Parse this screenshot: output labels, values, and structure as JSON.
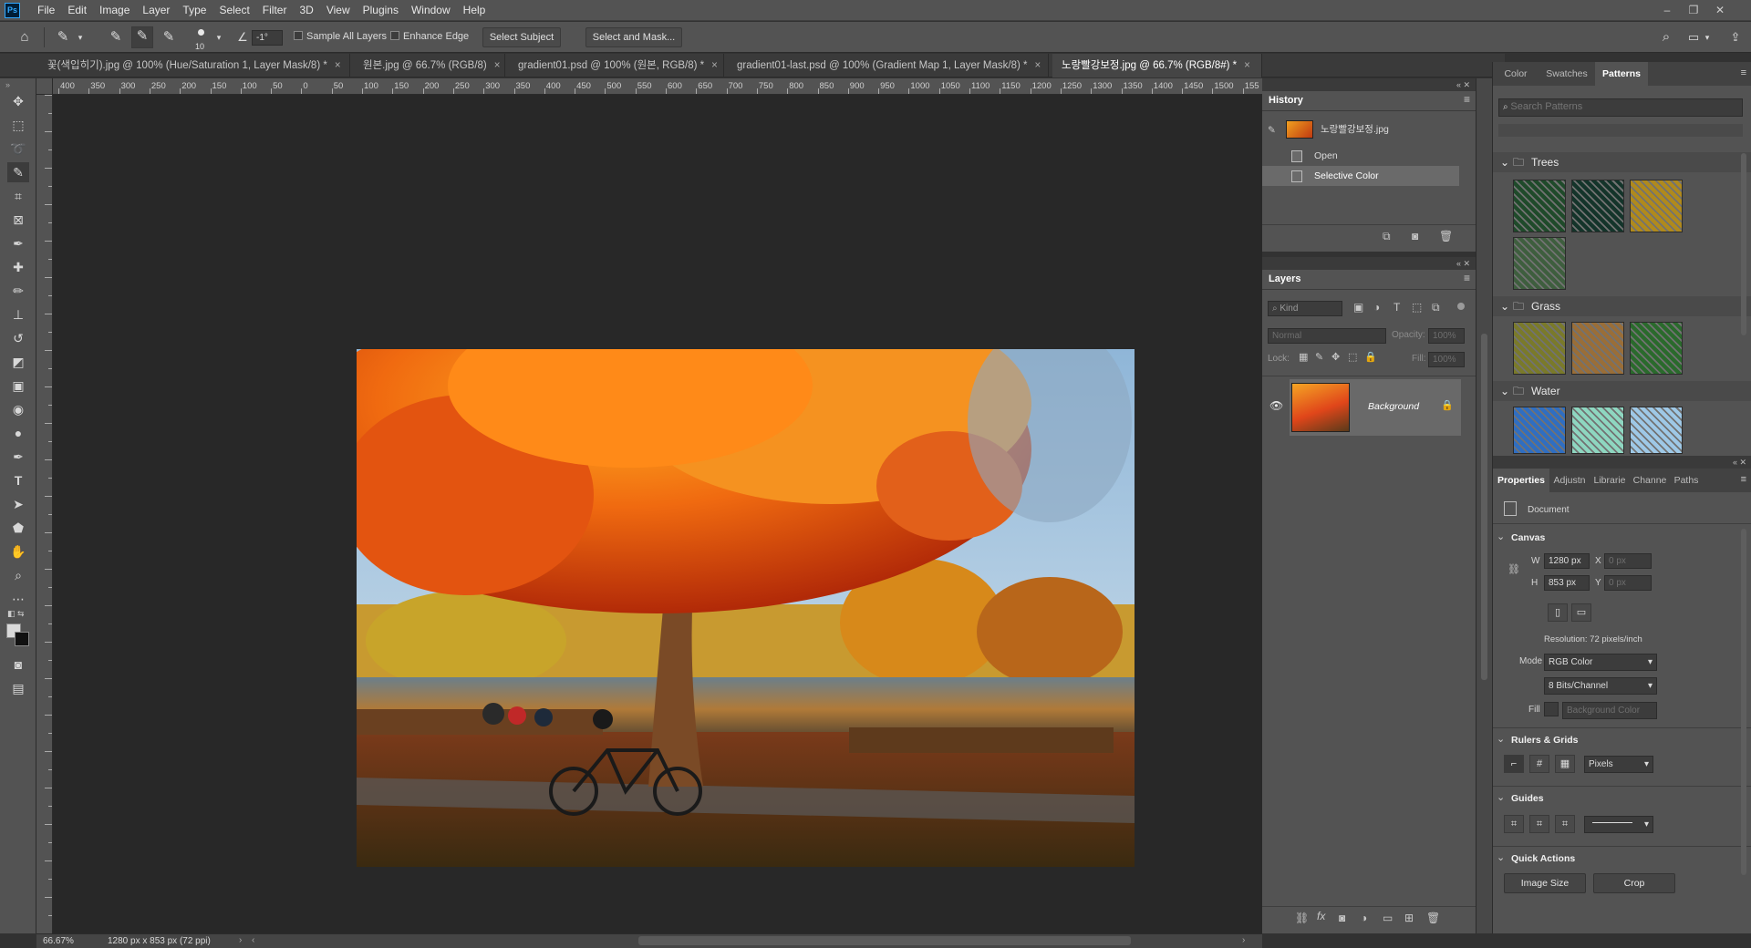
{
  "app": {
    "logo": "Ps"
  },
  "menu": [
    "File",
    "Edit",
    "Image",
    "Layer",
    "Type",
    "Select",
    "Filter",
    "3D",
    "View",
    "Plugins",
    "Window",
    "Help"
  ],
  "options": {
    "brush_size": "10",
    "angle": "-1°",
    "sample_all_layers": "Sample All Layers",
    "enhance_edge": "Enhance Edge",
    "select_subject": "Select Subject",
    "select_and_mask": "Select and Mask..."
  },
  "tabs": [
    {
      "label": "꽃(색입히기).jpg @ 100% (Hue/Saturation 1, Layer Mask/8) *"
    },
    {
      "label": "원본.jpg @ 66.7% (RGB/8)"
    },
    {
      "label": "gradient01.psd @ 100% (원본, RGB/8) *"
    },
    {
      "label": "gradient01-last.psd @ 100% (Gradient Map 1, Layer Mask/8) *"
    },
    {
      "label": "노랑빨강보정.jpg @ 66.7% (RGB/8#) *"
    }
  ],
  "ruler_ticks": [
    "400",
    "350",
    "300",
    "250",
    "200",
    "150",
    "100",
    "50",
    "0",
    "50",
    "100",
    "150",
    "200",
    "250",
    "300",
    "350",
    "400",
    "450",
    "500",
    "550",
    "600",
    "650",
    "700",
    "750",
    "800",
    "850",
    "900",
    "950",
    "1000",
    "1050",
    "1100",
    "1150",
    "1200",
    "1250",
    "1300",
    "1350",
    "1400",
    "1450",
    "1500",
    "155"
  ],
  "status": {
    "zoom": "66.67%",
    "doc_info": "1280 px x 853 px (72 ppi)"
  },
  "history": {
    "title": "History",
    "snapshot_name": "노랑빨강보정.jpg",
    "items": [
      "Open",
      "Selective Color"
    ]
  },
  "layers": {
    "title": "Layers",
    "kind_label": "Kind",
    "blend_mode": "Normal",
    "opacity_label": "Opacity:",
    "opacity_value": "100%",
    "lock_label": "Lock:",
    "fill_label": "Fill:",
    "fill_value": "100%",
    "layer_name": "Background"
  },
  "patterns_panel": {
    "tabs": [
      "Color",
      "Swatches",
      "Patterns"
    ],
    "search_placeholder": "Search Patterns",
    "groups": [
      {
        "name": "Trees",
        "swatches": [
          "#1f4a2a",
          "#14342a",
          "#b08a1c",
          "#3e5e3e"
        ]
      },
      {
        "name": "Grass",
        "swatches": [
          "#7a7a2a",
          "#9a6e38",
          "#2a6a2c"
        ]
      },
      {
        "name": "Water",
        "swatches": [
          "#2f6ec2",
          "#8ed6c0",
          "#9ec8e6"
        ]
      }
    ]
  },
  "properties": {
    "tabs": [
      "Properties",
      "Adjustn",
      "Librarie",
      "Channe",
      "Paths"
    ],
    "doc_label": "Document",
    "canvas_title": "Canvas",
    "w_label": "W",
    "w_value": "1280 px",
    "h_label": "H",
    "h_value": "853 px",
    "x_label": "X",
    "x_value": "0 px",
    "y_label": "Y",
    "y_value": "0 px",
    "resolution": "Resolution: 72 pixels/inch",
    "mode_label": "Mode",
    "mode_value": "RGB Color",
    "depth_value": "8 Bits/Channel",
    "fill_label": "Fill",
    "fill_value": "Background Color",
    "rulers_title": "Rulers & Grids",
    "units_value": "Pixels",
    "guides_title": "Guides",
    "quick_title": "Quick Actions",
    "image_size": "Image Size",
    "crop": "Crop"
  }
}
